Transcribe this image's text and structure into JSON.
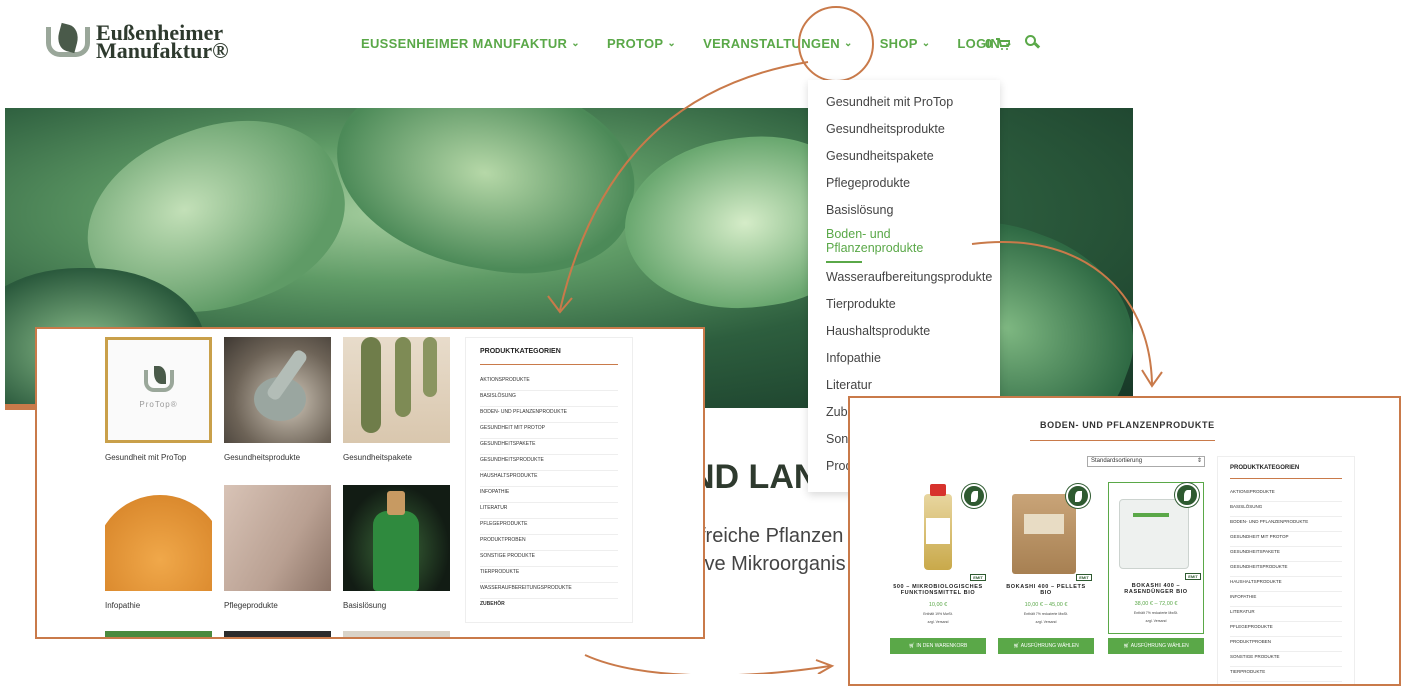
{
  "header": {
    "logo_line1": "Eußenheimer",
    "logo_line2": "Manufaktur®",
    "nav": [
      {
        "label": "EUSSENHEIMER MANUFAKTUR"
      },
      {
        "label": "PROTOP"
      },
      {
        "label": "VERANSTALTUNGEN"
      },
      {
        "label": "SHOP"
      },
      {
        "label": "LOGIN"
      }
    ],
    "cart_count": "0"
  },
  "hero": {
    "title": "ND LANI",
    "line1": "freiche Pflanzen",
    "line2": "ive Mikroorganis"
  },
  "dropdown": {
    "items": [
      "Gesundheit mit ProTop",
      "Gesundheitsprodukte",
      "Gesundheitspakete",
      "Pflegeprodukte",
      "Basislösung",
      "Boden- und Pflanzenprodukte",
      "Wasseraufbereitungsprodukte",
      "Tierprodukte",
      "Haushaltsprodukte",
      "Infopathie",
      "Literatur",
      "Zube",
      "Sons",
      "Prod"
    ],
    "active_index": 5
  },
  "category_overview": {
    "tiles": [
      {
        "label": "Gesundheit mit ProTop",
        "logo_text": "ProTop®"
      },
      {
        "label": "Gesundheitsprodukte"
      },
      {
        "label": "Gesundheitspakete"
      },
      {
        "label": "Infopathie"
      },
      {
        "label": "Pflegeprodukte"
      },
      {
        "label": "Basislösung"
      }
    ],
    "sidebar_title": "PRODUKTKATEGORIEN",
    "sidebar_items": [
      "AKTIONSPRODUKTE",
      "BASISLÖSUNG",
      "BODEN- UND PFLANZENPRODUKTE",
      "GESUNDHEIT MIT PROTOP",
      "GESUNDHEITSPAKETE",
      "GESUNDHEITSPRODUKTE",
      "HAUSHALTSPRODUKTE",
      "INFOPATHIE",
      "LITERATUR",
      "PFLEGEPRODUKTE",
      "PRODUKTPROBEN",
      "SONSTIGE PRODUKTE",
      "TIERPRODUKTE",
      "WASSERAUFBEREITUNGSPRODUKTE",
      "ZUBEHÖR"
    ]
  },
  "product_list": {
    "title": "BODEN- UND PFLANZENPRODUKTE",
    "sort_value": "Standardsortierung",
    "products": [
      {
        "name_line1": "500 – MIKROBIOLOGISCHES",
        "name_line2": "FUNKTIONSMITTEL BIO",
        "price": "10,00 €",
        "note1": "Enthält 19% MwSt.",
        "note2": "zzgl. Versand",
        "button": "IN DEN WARENKORB",
        "badge": "EMIT"
      },
      {
        "name_line1": "BOKASHI 400 – PELLETS",
        "name_line2": "BIO",
        "price": "10,00 € – 45,00 €",
        "note1": "Enthält 7% reduzierte MwSt.",
        "note2": "zzgl. Versand",
        "button": "AUSFÜHRUNG WÄHLEN",
        "badge": "EMIT"
      },
      {
        "name_line1": "BOKASHI 400 –",
        "name_line2": "RASENDÜNGER BIO",
        "price": "38,00 € – 72,00 €",
        "note1": "Enthält 7% reduzierte MwSt.",
        "note2": "zzgl. Versand",
        "button": "AUSFÜHRUNG WÄHLEN",
        "badge": "EMIT"
      }
    ],
    "sidebar_title": "PRODUKTKATEGORIEN",
    "sidebar_items": [
      "AKTIONSPRODUKTE",
      "BASISLÖSUNG",
      "BODEN- UND PFLANZENPRODUKTE",
      "GESUNDHEIT MIT PROTOP",
      "GESUNDHEITSPAKETE",
      "GESUNDHEITSPRODUKTE",
      "HAUSHALTSPRODUKTE",
      "INFOPATHIE",
      "LITERATUR",
      "PFLEGEPRODUKTE",
      "PRODUKTPROBEN",
      "SONSTIGE PRODUKTE",
      "TIERPRODUKTE"
    ]
  },
  "colors": {
    "brand_green": "#5aa848",
    "annotation_orange": "#c97a4a",
    "logo_dark": "#2e3a2e"
  }
}
